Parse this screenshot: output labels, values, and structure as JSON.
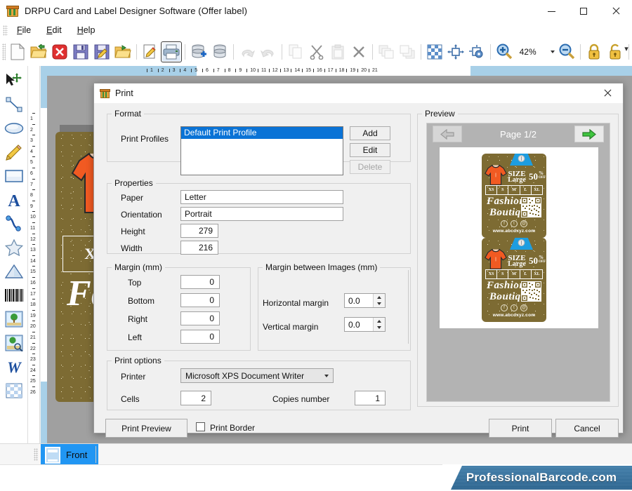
{
  "window": {
    "title": "DRPU Card and Label Designer Software (Offer label)",
    "app_icon": "package-icon",
    "controls": {
      "minimize": "minimize-icon",
      "maximize": "maximize-icon",
      "close": "close-icon"
    }
  },
  "menubar": {
    "items": [
      {
        "label": "File",
        "accel": "F"
      },
      {
        "label": "Edit",
        "accel": "E"
      },
      {
        "label": "Help",
        "accel": "H"
      }
    ]
  },
  "toolbar": {
    "zoom_value": "42%",
    "buttons": [
      {
        "name": "new-icon",
        "title": "New"
      },
      {
        "name": "open-icon",
        "title": "Open"
      },
      {
        "name": "close-doc-icon",
        "title": "Close"
      },
      {
        "name": "save-icon",
        "title": "Save"
      },
      {
        "name": "save-as-icon",
        "title": "Save As"
      },
      {
        "name": "export-icon",
        "title": "Export"
      },
      {
        "name": "edit-doc-icon",
        "title": "Edit Document"
      },
      {
        "name": "print-icon",
        "title": "Print"
      },
      {
        "name": "database-add-icon",
        "title": "Add Database"
      },
      {
        "name": "database-icon",
        "title": "Database"
      },
      {
        "name": "undo-icon",
        "title": "Undo"
      },
      {
        "name": "redo-icon",
        "title": "Redo"
      },
      {
        "name": "copy-icon",
        "title": "Copy"
      },
      {
        "name": "cut-icon",
        "title": "Cut"
      },
      {
        "name": "paste-icon",
        "title": "Paste"
      },
      {
        "name": "delete-icon",
        "title": "Delete"
      },
      {
        "name": "bring-front-icon",
        "title": "Bring to Front"
      },
      {
        "name": "send-back-icon",
        "title": "Send to Back"
      },
      {
        "name": "grid-icon",
        "title": "Grid"
      },
      {
        "name": "align-icon",
        "title": "Align"
      },
      {
        "name": "settings-align-icon",
        "title": "Align Settings"
      },
      {
        "name": "zoom-in-icon",
        "title": "Zoom In"
      },
      {
        "name": "zoom-out-icon",
        "title": "Zoom Out"
      },
      {
        "name": "lock-icon",
        "title": "Lock"
      },
      {
        "name": "unlock-icon",
        "title": "Unlock"
      }
    ]
  },
  "left_toolbox": {
    "tools": [
      {
        "name": "select-tool-icon",
        "label": "Select"
      },
      {
        "name": "line-tool-icon",
        "label": "Line"
      },
      {
        "name": "ellipse-tool-icon",
        "label": "Ellipse"
      },
      {
        "name": "pencil-tool-icon",
        "label": "Pencil"
      },
      {
        "name": "rectangle-tool-icon",
        "label": "Rectangle"
      },
      {
        "name": "text-tool-icon",
        "label": "Text"
      },
      {
        "name": "curve-tool-icon",
        "label": "Curve"
      },
      {
        "name": "star-tool-icon",
        "label": "Star"
      },
      {
        "name": "triangle-tool-icon",
        "label": "Triangle"
      },
      {
        "name": "barcode-tool-icon",
        "label": "Barcode"
      },
      {
        "name": "image-tool-icon",
        "label": "Image"
      },
      {
        "name": "image-edit-tool-icon",
        "label": "Image Settings"
      },
      {
        "name": "watermark-tool-icon",
        "label": "Watermark"
      },
      {
        "name": "pattern-tool-icon",
        "label": "Pattern"
      }
    ]
  },
  "rulers": {
    "horizontal_ticks": [
      "1",
      "2",
      "3",
      "4",
      "5",
      "6",
      "7",
      "8",
      "9",
      "10",
      "11",
      "12",
      "13",
      "14",
      "15",
      "16",
      "17",
      "18",
      "19",
      "20",
      "21"
    ],
    "vertical_ticks": [
      "1",
      "2",
      "3",
      "4",
      "5",
      "6",
      "7",
      "8",
      "9",
      "10",
      "11",
      "12",
      "13",
      "14",
      "15",
      "16",
      "17",
      "18",
      "19",
      "20",
      "21",
      "22",
      "23",
      "24",
      "25",
      "26"
    ]
  },
  "page_tabs": {
    "tabs": [
      {
        "label": "Front",
        "icon": "card-icon",
        "selected": true
      }
    ]
  },
  "brand": {
    "text": "ProfessionalBarcode.com"
  },
  "label_art": {
    "size_word_top": "SIZE",
    "size_word_bottom": "Large",
    "discount_number": "50",
    "discount_percent": "%",
    "discount_off": "OFF",
    "sizes": [
      "XS",
      "S",
      "M",
      "L",
      "XL"
    ],
    "brand_line1": "Fashion",
    "brand_line2": "Boutique",
    "website": "www.abcdxyz.com",
    "socials": [
      "f",
      "t",
      "@"
    ],
    "colors": {
      "background": "#7d6b33",
      "tshirt": "#f15a22",
      "hanger": "#1d9de0",
      "text": "#ffffff"
    }
  },
  "dialog": {
    "title": "Print",
    "icon": "package-icon",
    "close_icon": "close-icon",
    "format": {
      "legend": "Format",
      "print_profiles_label": "Print Profiles",
      "profiles": [
        "Default Print Profile"
      ],
      "selected_profile": "Default Print Profile",
      "add_button": "Add",
      "edit_button": "Edit",
      "delete_button": "Delete"
    },
    "properties": {
      "legend": "Properties",
      "paper_label": "Paper",
      "paper_value": "Letter",
      "orientation_label": "Orientation",
      "orientation_value": "Portrait",
      "height_label": "Height",
      "height_value": "279",
      "width_label": "Width",
      "width_value": "216"
    },
    "margin": {
      "legend": "Margin (mm)",
      "top_label": "Top",
      "top_value": "0",
      "bottom_label": "Bottom",
      "bottom_value": "0",
      "right_label": "Right",
      "right_value": "0",
      "left_label": "Left",
      "left_value": "0"
    },
    "margin_between": {
      "legend": "Margin between Images (mm)",
      "horizontal_label": "Horizontal margin",
      "horizontal_value": "0.0",
      "vertical_label": "Vertical margin",
      "vertical_value": "0.0"
    },
    "print_options": {
      "legend": "Print options",
      "printer_label": "Printer",
      "printer_value": "Microsoft XPS Document Writer",
      "cells_label": "Cells",
      "cells_value": "2",
      "copies_label": "Copies number",
      "copies_value": "1"
    },
    "footer": {
      "print_preview_button": "Print Preview",
      "print_border_label": "Print Border",
      "print_border_checked": false,
      "print_button": "Print",
      "cancel_button": "Cancel"
    },
    "preview": {
      "legend": "Preview",
      "page_indicator": "Page 1/2",
      "prev_icon": "arrow-left-icon",
      "next_icon": "arrow-right-icon",
      "prev_enabled": false,
      "next_enabled": true
    }
  }
}
